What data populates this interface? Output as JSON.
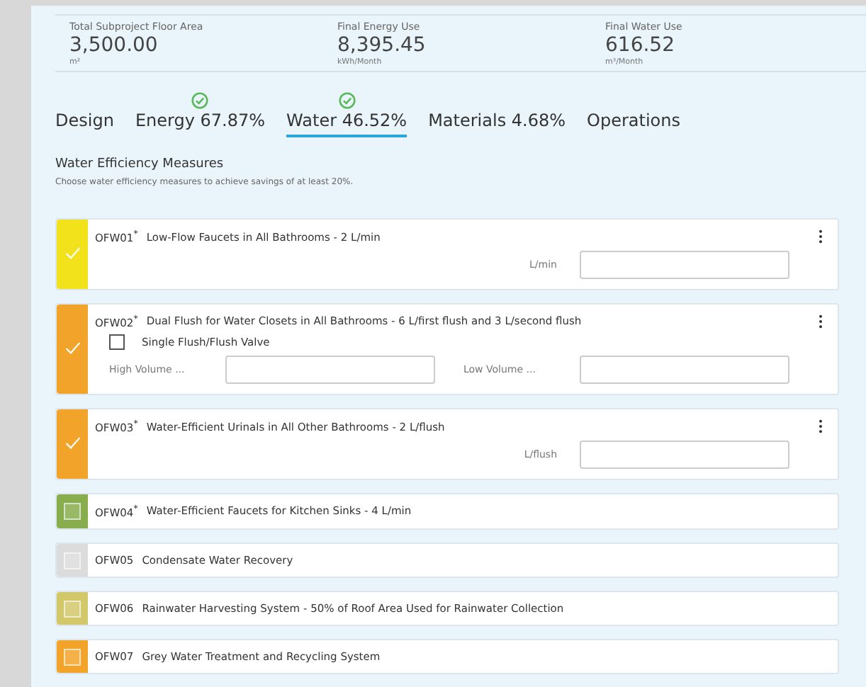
{
  "stats": [
    {
      "label": "Total Subproject Floor Area",
      "value": "3,500.00",
      "unit": "m²"
    },
    {
      "label": "Final Energy Use",
      "value": "8,395.45",
      "unit": "kWh/Month"
    },
    {
      "label": "Final Water Use",
      "value": "616.52",
      "unit": "m³/Month"
    }
  ],
  "tabs": [
    {
      "label": "Design",
      "selected": false,
      "achieved": false
    },
    {
      "label": "Energy 67.87%",
      "selected": false,
      "achieved": true
    },
    {
      "label": "Water 46.52%",
      "selected": true,
      "achieved": true
    },
    {
      "label": "Materials 4.68%",
      "selected": false,
      "achieved": false
    },
    {
      "label": "Operations",
      "selected": false,
      "achieved": false
    }
  ],
  "section": {
    "title": "Water Efficiency Measures",
    "subtitle": "Choose water efficiency measures to achieve savings of at least 20%."
  },
  "measures": [
    {
      "code": "OFW01$^{*}$",
      "title": "Low-Flow Faucets in All Bathrooms - 2 L/min",
      "checked": true,
      "color": "#f2e21c",
      "fields": [
        {
          "label": "L/min"
        }
      ]
    },
    {
      "code": "OFW02$^{*}$",
      "title": "Dual Flush for Water Closets in All Bathrooms - 6 L/first flush and 3 L/second flush",
      "checked": true,
      "color": "#f2a42a",
      "options": [
        {
          "label": "Single Flush/Flush Valve",
          "checked": false
        }
      ],
      "fields": [
        {
          "label": "High Volume ..."
        },
        {
          "label": "Low Volume ..."
        }
      ]
    },
    {
      "code": "OFW03$^{*}$",
      "title": "Water-Efficient Urinals in All Other Bathrooms - 2 L/flush",
      "checked": true,
      "color": "#f2a42a",
      "fields": [
        {
          "label": "L/flush"
        }
      ]
    },
    {
      "code": "OFW04$^{*}$",
      "title": "Water-Efficient Faucets for Kitchen Sinks - 4 L/min",
      "checked": false,
      "color": "#88ad4c"
    },
    {
      "code": "OFW05",
      "title": "Condensate Water Recovery",
      "checked": false,
      "color": "#dcdcdc"
    },
    {
      "code": "OFW06",
      "title": "Rainwater Harvesting System - 50% of Roof Area Used for Rainwater Collection",
      "checked": false,
      "color": "#d2c86a"
    },
    {
      "code": "OFW07",
      "title": "Grey Water Treatment and Recycling System",
      "checked": false,
      "color": "#f2a42a"
    }
  ]
}
